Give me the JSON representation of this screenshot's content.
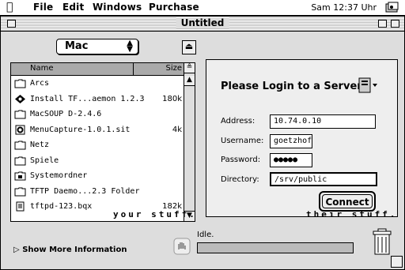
{
  "menubar": {
    "items": [
      "File",
      "Edit",
      "Windows",
      "Purchase"
    ],
    "clock": "Sam 12:37 Uhr"
  },
  "window": {
    "title": "Untitled"
  },
  "location_popup": {
    "value": "Mac"
  },
  "file_list": {
    "columns": {
      "name": "Name",
      "size": "Size"
    },
    "rows": [
      {
        "name": "Arcs",
        "size": "",
        "icon": "folder-icon"
      },
      {
        "name": "Install TF...aemon 1.2.3",
        "size": "180k",
        "icon": "installer-icon"
      },
      {
        "name": "MacSOUP D-2.4.6",
        "size": "",
        "icon": "folder-icon"
      },
      {
        "name": "MenuCapture-1.0.1.sit",
        "size": "4k",
        "icon": "archive-icon"
      },
      {
        "name": "Netz",
        "size": "",
        "icon": "folder-icon"
      },
      {
        "name": "Spiele",
        "size": "",
        "icon": "folder-icon"
      },
      {
        "name": "Systemordner",
        "size": "",
        "icon": "system-folder-icon"
      },
      {
        "name": "TFTP Daemo...2.3 Folder",
        "size": "",
        "icon": "folder-icon"
      },
      {
        "name": "tftpd-123.bqx",
        "size": "182k",
        "icon": "document-icon"
      }
    ]
  },
  "login": {
    "heading": "Please Login to a Server",
    "fields": {
      "address_label": "Address:",
      "address_value": "10.74.0.10",
      "username_label": "Username:",
      "username_value": "goetzhoffa",
      "password_label": "Password:",
      "password_value": "●●●●●",
      "directory_label": "Directory:",
      "directory_value": "/srv/public"
    },
    "connect_label": "Connect"
  },
  "taglines": {
    "left": "your stuff.",
    "right": "their stuff."
  },
  "footer": {
    "show_more": "Show More Information",
    "status": "Idle."
  }
}
